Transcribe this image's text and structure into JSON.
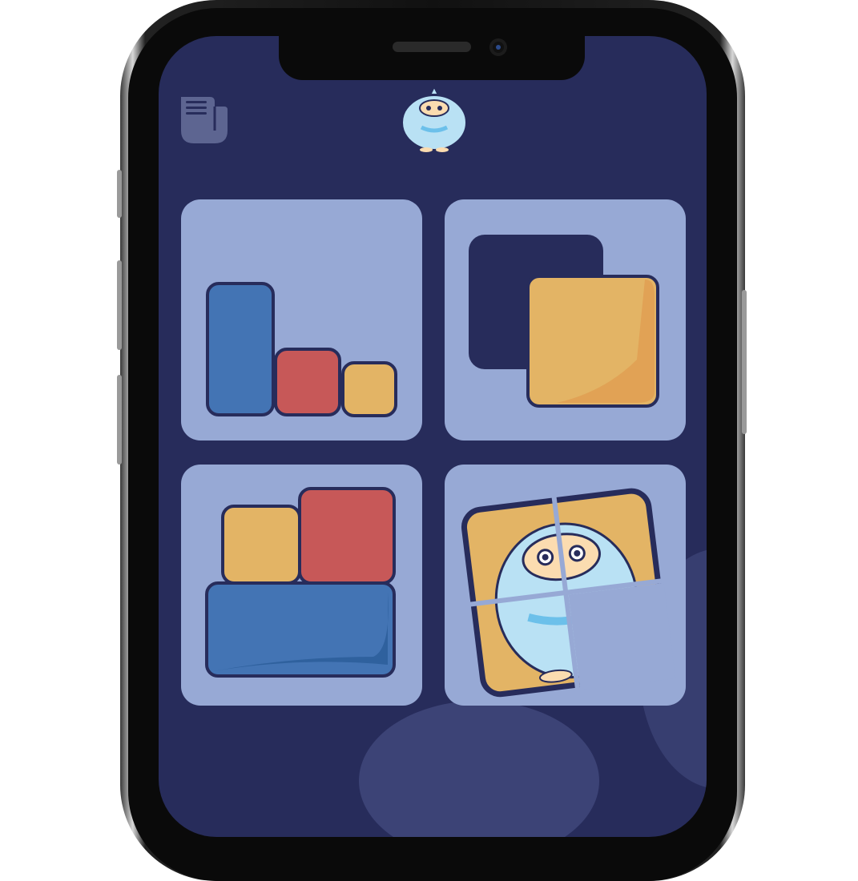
{
  "app": {
    "mascot_icon": "yeti-mascot-icon",
    "menu_icon": "scroll-document-icon"
  },
  "colors": {
    "background": "#272c5b",
    "card": "#97a9d5",
    "blue": "#4374b4",
    "red": "#c75858",
    "yellow": "#e3b465",
    "outline": "#272c5b"
  },
  "levels": [
    {
      "icon": "sort-blocks-by-size-icon"
    },
    {
      "icon": "fit-square-into-slot-icon"
    },
    {
      "icon": "stack-blocks-icon"
    },
    {
      "icon": "jigsaw-puzzle-yeti-icon"
    }
  ]
}
